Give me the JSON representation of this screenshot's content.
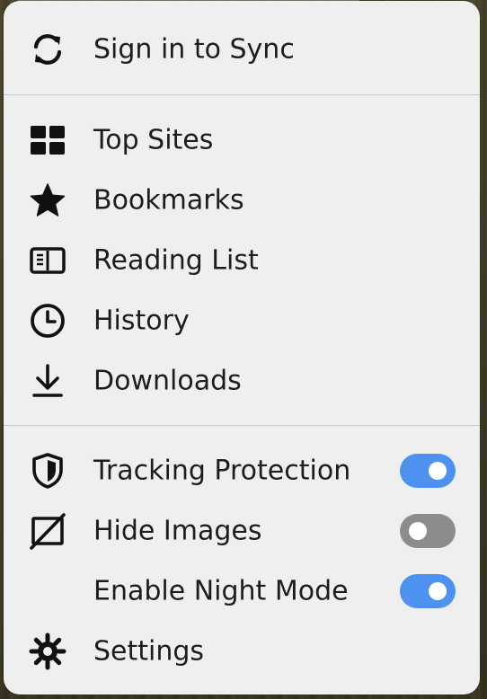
{
  "menu": {
    "sync": {
      "label": "Sign in to Sync",
      "icon": "sync-icon"
    },
    "library": [
      {
        "label": "Top Sites",
        "icon": "top-sites-icon"
      },
      {
        "label": "Bookmarks",
        "icon": "bookmark-star-icon"
      },
      {
        "label": "Reading List",
        "icon": "reading-list-icon"
      },
      {
        "label": "History",
        "icon": "history-clock-icon"
      },
      {
        "label": "Downloads",
        "icon": "download-icon"
      }
    ],
    "settings_section": {
      "tracking_protection": {
        "label": "Tracking Protection",
        "icon": "shield-icon",
        "enabled": true
      },
      "hide_images": {
        "label": "Hide Images",
        "icon": "hide-images-icon",
        "enabled": false
      },
      "night_mode": {
        "label": "Enable Night Mode",
        "icon": "moon-icon",
        "enabled": true
      },
      "settings": {
        "label": "Settings",
        "icon": "gear-icon"
      }
    }
  },
  "colors": {
    "menu_background": "#efefef",
    "toggle_on": "#4e92f1",
    "toggle_off": "#8c8c8c",
    "text": "#1d1d1f"
  }
}
